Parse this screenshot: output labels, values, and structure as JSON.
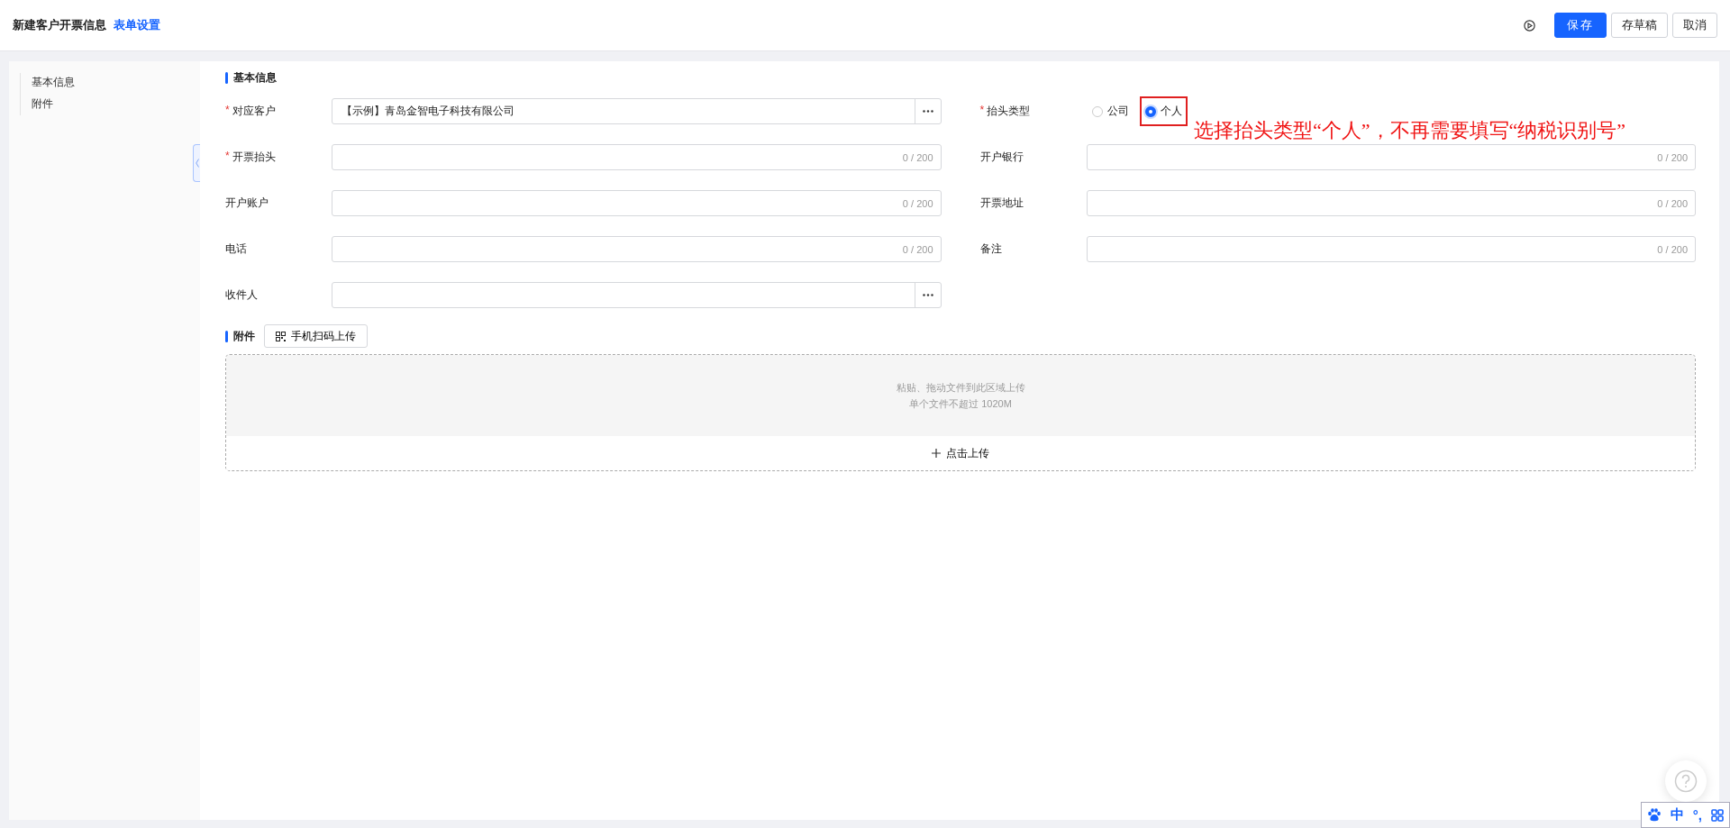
{
  "header": {
    "title": "新建客户开票信息",
    "settings_link": "表单设置",
    "buttons": [
      {
        "label": "保存",
        "kind": "primary"
      },
      {
        "label": "存草稿",
        "kind": "default"
      },
      {
        "label": "取消",
        "kind": "default"
      }
    ]
  },
  "sidebar": {
    "items": [
      {
        "label": "基本信息"
      },
      {
        "label": "附件"
      }
    ]
  },
  "basic": {
    "title": "基本信息",
    "fields": [
      {
        "label": "对应客户",
        "required_mark": "*",
        "kind": "lookup",
        "value": "【示例】青岛金智电子科技有限公司"
      },
      {
        "label": "抬头类型",
        "required_mark": "*",
        "kind": "radio",
        "options": [
          {
            "label": "公司",
            "selected": false,
            "highlighted": false
          },
          {
            "label": "个人",
            "selected": true,
            "highlighted": true
          }
        ]
      },
      {
        "label": "开票抬头",
        "required_mark": "*",
        "kind": "text",
        "counter": "0 / 200"
      },
      {
        "label": "开户银行",
        "kind": "text",
        "counter": "0 / 200"
      },
      {
        "label": "开户账户",
        "kind": "text",
        "counter": "0 / 200"
      },
      {
        "label": "开票地址",
        "kind": "text",
        "counter": "0 / 200"
      },
      {
        "label": "电话",
        "kind": "text",
        "counter": "0 / 200"
      },
      {
        "label": "备注",
        "kind": "text",
        "counter": "0 / 200"
      },
      {
        "label": "收件人",
        "kind": "lookup"
      }
    ]
  },
  "annotation": {
    "text": "选择抬头类型“个人”，不再需要填写“纳税识别号”"
  },
  "attachments": {
    "title": "附件",
    "scan_button": "手机扫码上传",
    "hint_lines": [
      "粘贴、拖动文件到此区域上传",
      "单个文件不超过 1020M"
    ],
    "upload_button": "点击上传"
  },
  "ime": {
    "labels": [
      "中",
      "°,"
    ]
  }
}
